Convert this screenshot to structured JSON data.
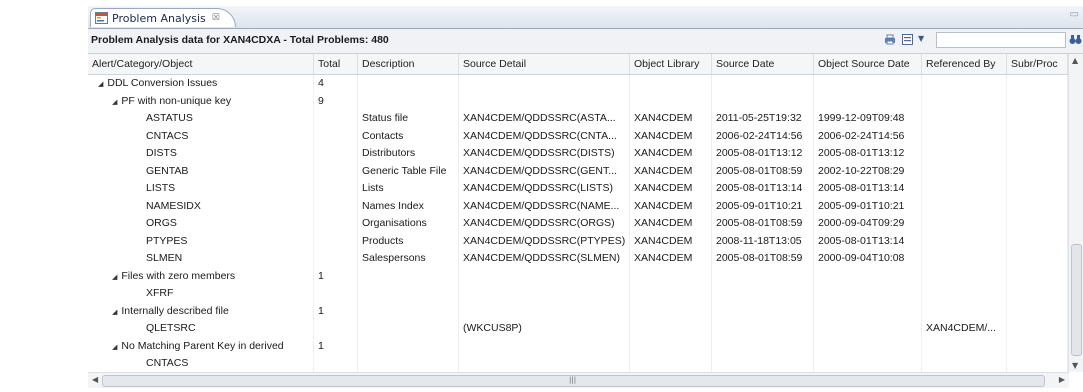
{
  "tab": {
    "title": "Problem Analysis",
    "close": "☒"
  },
  "header": {
    "title": "Problem Analysis data for XAN4CDXA - Total Problems: 480"
  },
  "columns": [
    "Alert/Category/Object",
    "Total",
    "Description",
    "Source Detail",
    "Object Library",
    "Source Date",
    "Object Source Date",
    "Referenced By",
    "Subr/Proc"
  ],
  "rows": [
    {
      "name": "DDL Conversion Issues",
      "total": "4",
      "indent": 1,
      "twisty": "◢",
      "desc": "",
      "src": "",
      "lib": "",
      "sdate": "",
      "odate": "",
      "ref": ""
    },
    {
      "name": "PF with non-unique key",
      "total": "9",
      "indent": 2,
      "twisty": "◢",
      "desc": "",
      "src": "",
      "lib": "",
      "sdate": "",
      "odate": "",
      "ref": ""
    },
    {
      "name": "ASTATUS",
      "total": "",
      "indent": 3,
      "twisty": "",
      "desc": "Status file",
      "src": "XAN4CDEM/QDDSSRC(ASTA...",
      "lib": "XAN4CDEM",
      "sdate": "2011-05-25T19:32",
      "odate": "1999-12-09T09:48",
      "ref": ""
    },
    {
      "name": "CNTACS",
      "total": "",
      "indent": 3,
      "twisty": "",
      "desc": "Contacts",
      "src": "XAN4CDEM/QDDSSRC(CNTA...",
      "lib": "XAN4CDEM",
      "sdate": "2006-02-24T14:56",
      "odate": "2006-02-24T14:56",
      "ref": ""
    },
    {
      "name": "DISTS",
      "total": "",
      "indent": 3,
      "twisty": "",
      "desc": "Distributors",
      "src": "XAN4CDEM/QDDSSRC(DISTS)",
      "lib": "XAN4CDEM",
      "sdate": "2005-08-01T13:12",
      "odate": "2005-08-01T13:12",
      "ref": ""
    },
    {
      "name": "GENTAB",
      "total": "",
      "indent": 3,
      "twisty": "",
      "desc": "Generic Table File",
      "src": "XAN4CDEM/QDDSSRC(GENT...",
      "lib": "XAN4CDEM",
      "sdate": "2005-08-01T08:59",
      "odate": "2002-10-22T08:29",
      "ref": ""
    },
    {
      "name": "LISTS",
      "total": "",
      "indent": 3,
      "twisty": "",
      "desc": "Lists",
      "src": "XAN4CDEM/QDDSSRC(LISTS)",
      "lib": "XAN4CDEM",
      "sdate": "2005-08-01T13:14",
      "odate": "2005-08-01T13:14",
      "ref": ""
    },
    {
      "name": "NAMESIDX",
      "total": "",
      "indent": 3,
      "twisty": "",
      "desc": "Names Index",
      "src": "XAN4CDEM/QDDSSRC(NAME...",
      "lib": "XAN4CDEM",
      "sdate": "2005-09-01T10:21",
      "odate": "2005-09-01T10:21",
      "ref": ""
    },
    {
      "name": "ORGS",
      "total": "",
      "indent": 3,
      "twisty": "",
      "desc": "Organisations",
      "src": "XAN4CDEM/QDDSSRC(ORGS)",
      "lib": "XAN4CDEM",
      "sdate": "2005-08-01T08:59",
      "odate": "2000-09-04T09:29",
      "ref": ""
    },
    {
      "name": "PTYPES",
      "total": "",
      "indent": 3,
      "twisty": "",
      "desc": "Products",
      "src": "XAN4CDEM/QDDSSRC(PTYPES)",
      "lib": "XAN4CDEM",
      "sdate": "2008-11-18T13:05",
      "odate": "2005-08-01T13:14",
      "ref": ""
    },
    {
      "name": "SLMEN",
      "total": "",
      "indent": 3,
      "twisty": "",
      "desc": "Salespersons",
      "src": "XAN4CDEM/QDDSSRC(SLMEN)",
      "lib": "XAN4CDEM",
      "sdate": "2005-08-01T08:59",
      "odate": "2000-09-04T10:08",
      "ref": ""
    },
    {
      "name": "Files with zero members",
      "total": "1",
      "indent": 2,
      "twisty": "◢",
      "desc": "",
      "src": "",
      "lib": "",
      "sdate": "",
      "odate": "",
      "ref": ""
    },
    {
      "name": "XFRF",
      "total": "",
      "indent": 3,
      "twisty": "",
      "desc": "",
      "src": "",
      "lib": "",
      "sdate": "",
      "odate": "",
      "ref": ""
    },
    {
      "name": "Internally described file",
      "total": "1",
      "indent": 2,
      "twisty": "◢",
      "desc": "",
      "src": "",
      "lib": "",
      "sdate": "",
      "odate": "",
      "ref": ""
    },
    {
      "name": "QLETSRC",
      "total": "",
      "indent": 3,
      "twisty": "",
      "desc": "",
      "src": "(WKCUS8P)",
      "lib": "",
      "sdate": "",
      "odate": "",
      "ref": "XAN4CDEM/..."
    },
    {
      "name": "No Matching Parent Key in derived",
      "total": "1",
      "indent": 2,
      "twisty": "◢",
      "desc": "",
      "src": "",
      "lib": "",
      "sdate": "",
      "odate": "",
      "ref": ""
    },
    {
      "name": "CNTACS",
      "total": "",
      "indent": 3,
      "twisty": "",
      "desc": "",
      "src": "",
      "lib": "",
      "sdate": "",
      "odate": "",
      "ref": ""
    }
  ],
  "colors": {
    "tab_border": "#9aa9bd",
    "header_bg": "#f0f2f6",
    "accent": "#3a5a8c"
  },
  "icons": {
    "tab": "problem-analysis-icon",
    "print": "print-icon",
    "menu": "view-menu-icon",
    "binoculars": "binoculars-icon"
  }
}
